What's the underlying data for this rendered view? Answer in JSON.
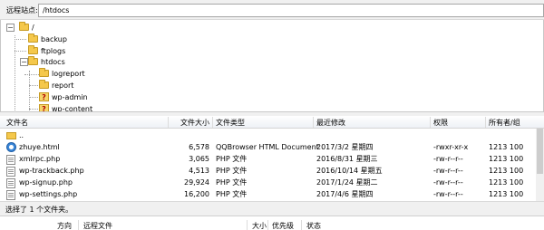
{
  "remote_site": {
    "label": "远程站点:",
    "path": "/htdocs"
  },
  "tree": {
    "root": "/",
    "items": [
      {
        "label": "backup"
      },
      {
        "label": "ftplogs"
      },
      {
        "label": "htdocs"
      },
      {
        "label": "logreport"
      },
      {
        "label": "report"
      },
      {
        "label": "wp-admin"
      },
      {
        "label": "wp-content"
      }
    ]
  },
  "file_list": {
    "columns": {
      "name": "文件名",
      "size": "文件大小",
      "type": "文件类型",
      "modified": "最近修改",
      "permissions": "权限",
      "owner": "所有者/组"
    },
    "parent_dir": "..",
    "rows": [
      {
        "name": "zhuye.html",
        "size": "6,578",
        "type": "QQBrowser HTML Document",
        "modified": "2017/3/2 星期四",
        "permissions": "-rwxr-xr-x",
        "owner": "1213 100"
      },
      {
        "name": "xmlrpc.php",
        "size": "3,065",
        "type": "PHP 文件",
        "modified": "2016/8/31 星期三",
        "permissions": "-rw-r--r--",
        "owner": "1213 100"
      },
      {
        "name": "wp-trackback.php",
        "size": "4,513",
        "type": "PHP 文件",
        "modified": "2016/10/14 星期五",
        "permissions": "-rw-r--r--",
        "owner": "1213 100"
      },
      {
        "name": "wp-signup.php",
        "size": "29,924",
        "type": "PHP 文件",
        "modified": "2017/1/24 星期二",
        "permissions": "-rw-r--r--",
        "owner": "1213 100"
      },
      {
        "name": "wp-settings.php",
        "size": "16,200",
        "type": "PHP 文件",
        "modified": "2017/4/6 星期四",
        "permissions": "-rw-r--r--",
        "owner": "1213 100"
      }
    ]
  },
  "status_bar": {
    "text": "选择了 1 个文件夹。"
  },
  "queue": {
    "columns": {
      "server_local": "方向",
      "remote_file": "远程文件",
      "size": "大小",
      "priority": "优先级",
      "status": "状态"
    }
  }
}
